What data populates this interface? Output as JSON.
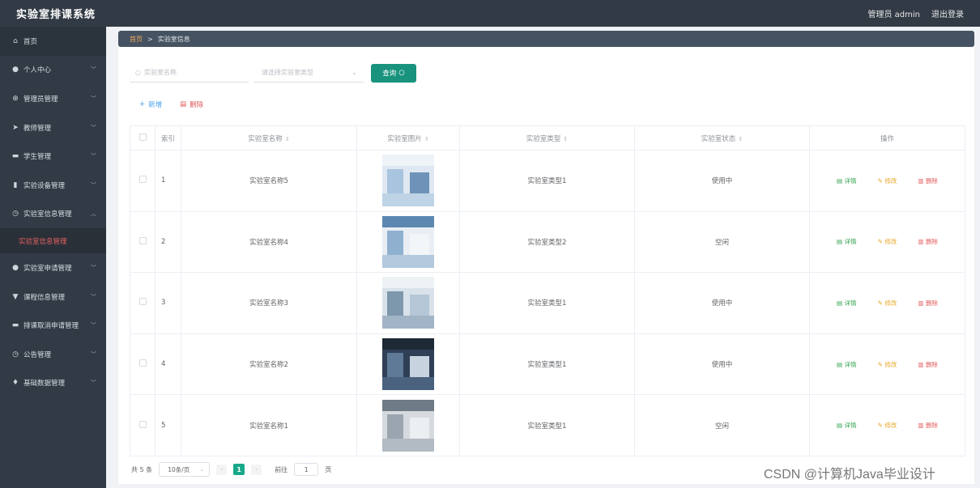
{
  "app": {
    "title": "实验室排课系统",
    "user": "管理员 admin",
    "logout": "退出登录"
  },
  "sidebar": {
    "items": [
      {
        "label": "首页",
        "icon": "home-icon",
        "glyph": "⌂",
        "chev": false
      },
      {
        "label": "个人中心",
        "icon": "user-icon",
        "glyph": "●",
        "chev": true
      },
      {
        "label": "管理员管理",
        "icon": "globe-icon",
        "glyph": "⊕",
        "chev": true
      },
      {
        "label": "教师管理",
        "icon": "send-icon",
        "glyph": "➤",
        "chev": true
      },
      {
        "label": "学生管理",
        "icon": "chat-icon",
        "glyph": "▬",
        "chev": true
      },
      {
        "label": "实验设备管理",
        "icon": "chart-icon",
        "glyph": "▮",
        "chev": true
      },
      {
        "label": "实验室信息管理",
        "icon": "compass-icon",
        "glyph": "◷",
        "chev": true,
        "expanded": true
      },
      {
        "label": "实验室申请管理",
        "icon": "user-icon",
        "glyph": "●",
        "chev": true
      },
      {
        "label": "课程信息管理",
        "icon": "tag-icon",
        "glyph": "▼",
        "chev": true
      },
      {
        "label": "排课取消申请管理",
        "icon": "card-icon",
        "glyph": "▬",
        "chev": true
      },
      {
        "label": "公告管理",
        "icon": "clock-icon",
        "glyph": "◷",
        "chev": true
      },
      {
        "label": "基础数据管理",
        "icon": "mic-icon",
        "glyph": "♦",
        "chev": true
      }
    ],
    "submenu": "实验室信息管理"
  },
  "breadcrumb": {
    "home": "首页",
    "sep": ">",
    "current": "实验室信息"
  },
  "search": {
    "placeholder": "实验室名称",
    "type_placeholder": "请选择实验室类型",
    "query": "查询"
  },
  "actions": {
    "add": "新增",
    "delete": "删除"
  },
  "table": {
    "headers": [
      "索引",
      "实验室名称",
      "实验室图片",
      "实验室类型",
      "实验室状态",
      "操作"
    ],
    "rows": [
      {
        "index": "1",
        "name": "实验室名称5",
        "type": "实验室类型1",
        "status": "使用中"
      },
      {
        "index": "2",
        "name": "实验室名称4",
        "type": "实验室类型2",
        "status": "空闲"
      },
      {
        "index": "3",
        "name": "实验室名称3",
        "type": "实验室类型1",
        "status": "使用中"
      },
      {
        "index": "4",
        "name": "实验室名称2",
        "type": "实验室类型1",
        "status": "使用中"
      },
      {
        "index": "5",
        "name": "实验室名称1",
        "type": "实验室类型1",
        "status": "空闲"
      }
    ],
    "ops": {
      "detail": "详情",
      "edit": "修改",
      "del": "删除"
    }
  },
  "pager": {
    "total": "共 5 条",
    "size": "10条/页",
    "page": "1",
    "goto_label": "前往",
    "goto_value": "1",
    "goto_suffix": "页"
  },
  "watermark": "CSDN @计算机Java毕业设计",
  "colors": {
    "accent": "#19937d",
    "sidebar": "#323b45",
    "danger": "#e15a5a",
    "edit": "#e6a82a",
    "detail": "#2fa24a"
  }
}
